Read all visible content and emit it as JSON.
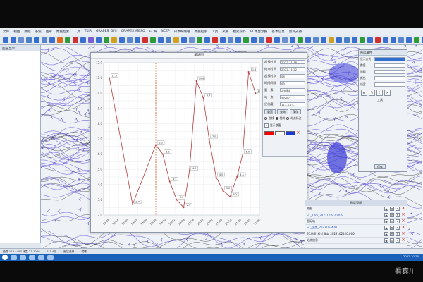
{
  "menu": [
    "文件",
    "视图",
    "数据",
    "系统",
    "图形",
    "数据检索",
    "工具",
    "TKIR",
    "GRAPES_GFS",
    "GRAPES_MESO",
    "EC细",
    "NCEP",
    "日本细网格",
    "数据检索",
    "工具",
    "风暴",
    "模式操作",
    "EC集合预报",
    "基本信息",
    "会商支持"
  ],
  "left_pane": {
    "header": "图层显示"
  },
  "chart_window": {
    "title": "单站图",
    "unit": "单位(℃)"
  },
  "chart_data": {
    "type": "line",
    "title": "单站图",
    "ylabel": "单位(℃)",
    "x": [
      "18/08",
      "18/14",
      "18/20",
      "19/02",
      "19/08",
      "19/14",
      "19/20",
      "20/02",
      "20/08",
      "20/14",
      "20/20",
      "21/02",
      "21/08",
      "21/14",
      "21/20",
      "22/02",
      "22/08"
    ],
    "values": [
      11.0,
      null,
      2.7,
      null,
      6.6,
      6.0,
      4.2,
      3.0,
      2.5,
      4.9,
      10.8,
      9.7,
      7.0,
      4.5,
      3.6,
      3.2,
      4.5,
      6.0,
      11.4,
      10.0
    ],
    "points": [
      {
        "x": 0,
        "y": 11.0
      },
      {
        "x": 2,
        "y": 2.7
      },
      {
        "x": 4,
        "y": 6.6
      },
      {
        "x": 4.6,
        "y": 6.0
      },
      {
        "x": 5.2,
        "y": 4.2
      },
      {
        "x": 5.8,
        "y": 3.0
      },
      {
        "x": 6.4,
        "y": 2.5
      },
      {
        "x": 6.9,
        "y": 4.9
      },
      {
        "x": 7.5,
        "y": 10.8
      },
      {
        "x": 8.1,
        "y": 9.7
      },
      {
        "x": 8.6,
        "y": 7.0
      },
      {
        "x": 9.2,
        "y": 4.5
      },
      {
        "x": 9.8,
        "y": 3.6
      },
      {
        "x": 10.4,
        "y": 3.2
      },
      {
        "x": 11.0,
        "y": 4.5
      },
      {
        "x": 11.5,
        "y": 6.0
      },
      {
        "x": 12.0,
        "y": 11.4
      },
      {
        "x": 12.6,
        "y": 10.0
      }
    ],
    "ylim": [
      2,
      12
    ],
    "xlim": [
      -0.5,
      13
    ],
    "grid": true,
    "line_color": "#b43c3c",
    "marker_line_x": 4
  },
  "query_panel": {
    "rows": [
      {
        "label": "起报时间",
        "value": "2022-11-18"
      },
      {
        "label": "结束时间",
        "value": "2022-11-22"
      },
      {
        "label": "起报时次",
        "value": "08"
      },
      {
        "label": "时间间隔",
        "value": "03"
      },
      {
        "label": "要　素",
        "value": "2m温度"
      },
      {
        "label": "站　点",
        "value": "59287"
      },
      {
        "label": "经纬度",
        "value": "113.4,23.1"
      }
    ],
    "buttons": [
      "重置",
      "查询",
      "保存"
    ],
    "radios": [
      "曲线",
      "柱状",
      "站点标注"
    ],
    "checkbox": "显示数值",
    "colors": [
      "#ff0000",
      "#ffffff",
      "#1a3ad0"
    ]
  },
  "prop_panel": {
    "header": "图层属性",
    "rows": [
      "显示方式",
      "数值",
      "间隔",
      "颜色",
      "线宽"
    ],
    "section": "工具",
    "footer": "保存"
  },
  "layer_panel": {
    "header": "图层管理",
    "layers": [
      {
        "name": "地图",
        "selected": false
      },
      {
        "name": "EC_T2m_2022102420.024",
        "selected": true
      },
      {
        "name": "国际站",
        "selected": false
      },
      {
        "name": "EC_温度_2022102420",
        "selected": true
      },
      {
        "name": "EC地面_相对湿度_2022102420.000",
        "selected": false
      },
      {
        "name": "站点信息",
        "selected": false
      }
    ]
  },
  "statusbar": {
    "coords": "经度 113.4497 纬度 23.1008",
    "scale": "1:3.4亿",
    "mode": "图层选择",
    "status": "就绪"
  },
  "taskbar": {
    "clock": "2022-10-25"
  },
  "watermark": "看宾川"
}
